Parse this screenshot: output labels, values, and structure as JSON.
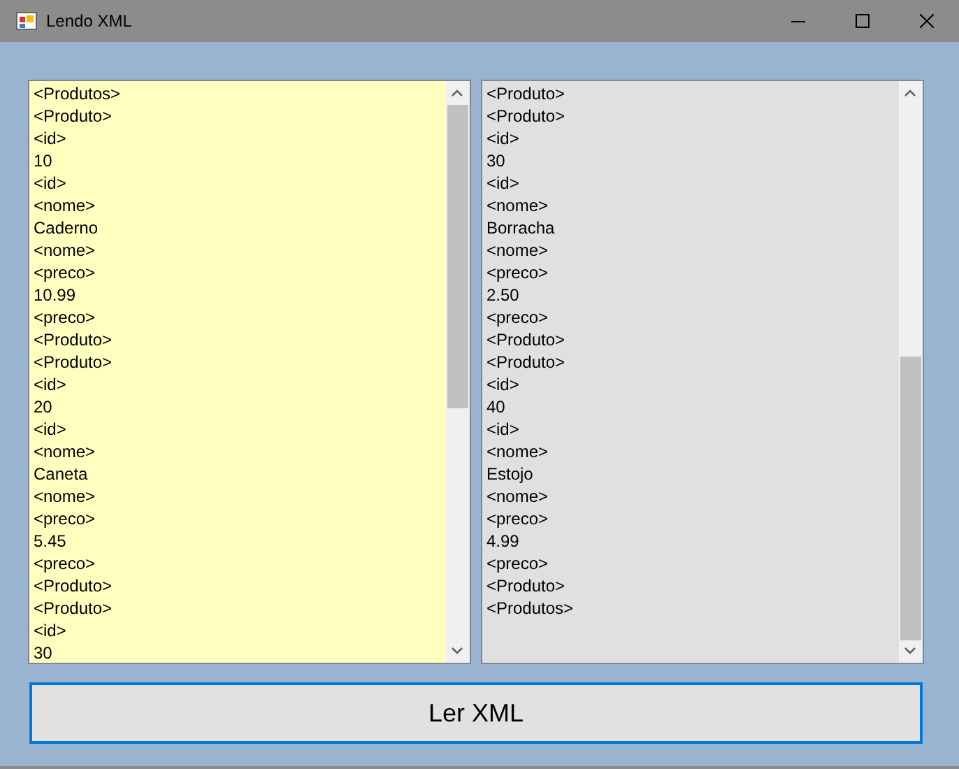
{
  "window": {
    "title": "Lendo XML"
  },
  "text_boxes": [
    {
      "readonly": false,
      "lines": [
        "<Produtos>",
        "<Produto>",
        "<id>",
        "10",
        "<id>",
        "<nome>",
        "Caderno",
        "<nome>",
        "<preco>",
        "10.99",
        "<preco>",
        "<Produto>",
        "<Produto>",
        "<id>",
        "20",
        "<id>",
        "<nome>",
        "Caneta",
        "<nome>",
        "<preco>",
        "5.45",
        "<preco>",
        "<Produto>",
        "<Produto>",
        "<id>",
        "30"
      ]
    },
    {
      "readonly": true,
      "lines": [
        "<Produto>",
        "<Produto>",
        "<id>",
        "30",
        "<id>",
        "<nome>",
        "Borracha",
        "<nome>",
        "<preco>",
        "2.50",
        "<preco>",
        "<Produto>",
        "<Produto>",
        "<id>",
        "40",
        "<id>",
        "<nome>",
        "Estojo",
        "<nome>",
        "<preco>",
        "4.99",
        "<preco>",
        "<Produto>",
        "<Produtos>"
      ]
    }
  ],
  "button": {
    "label": "Ler XML"
  }
}
